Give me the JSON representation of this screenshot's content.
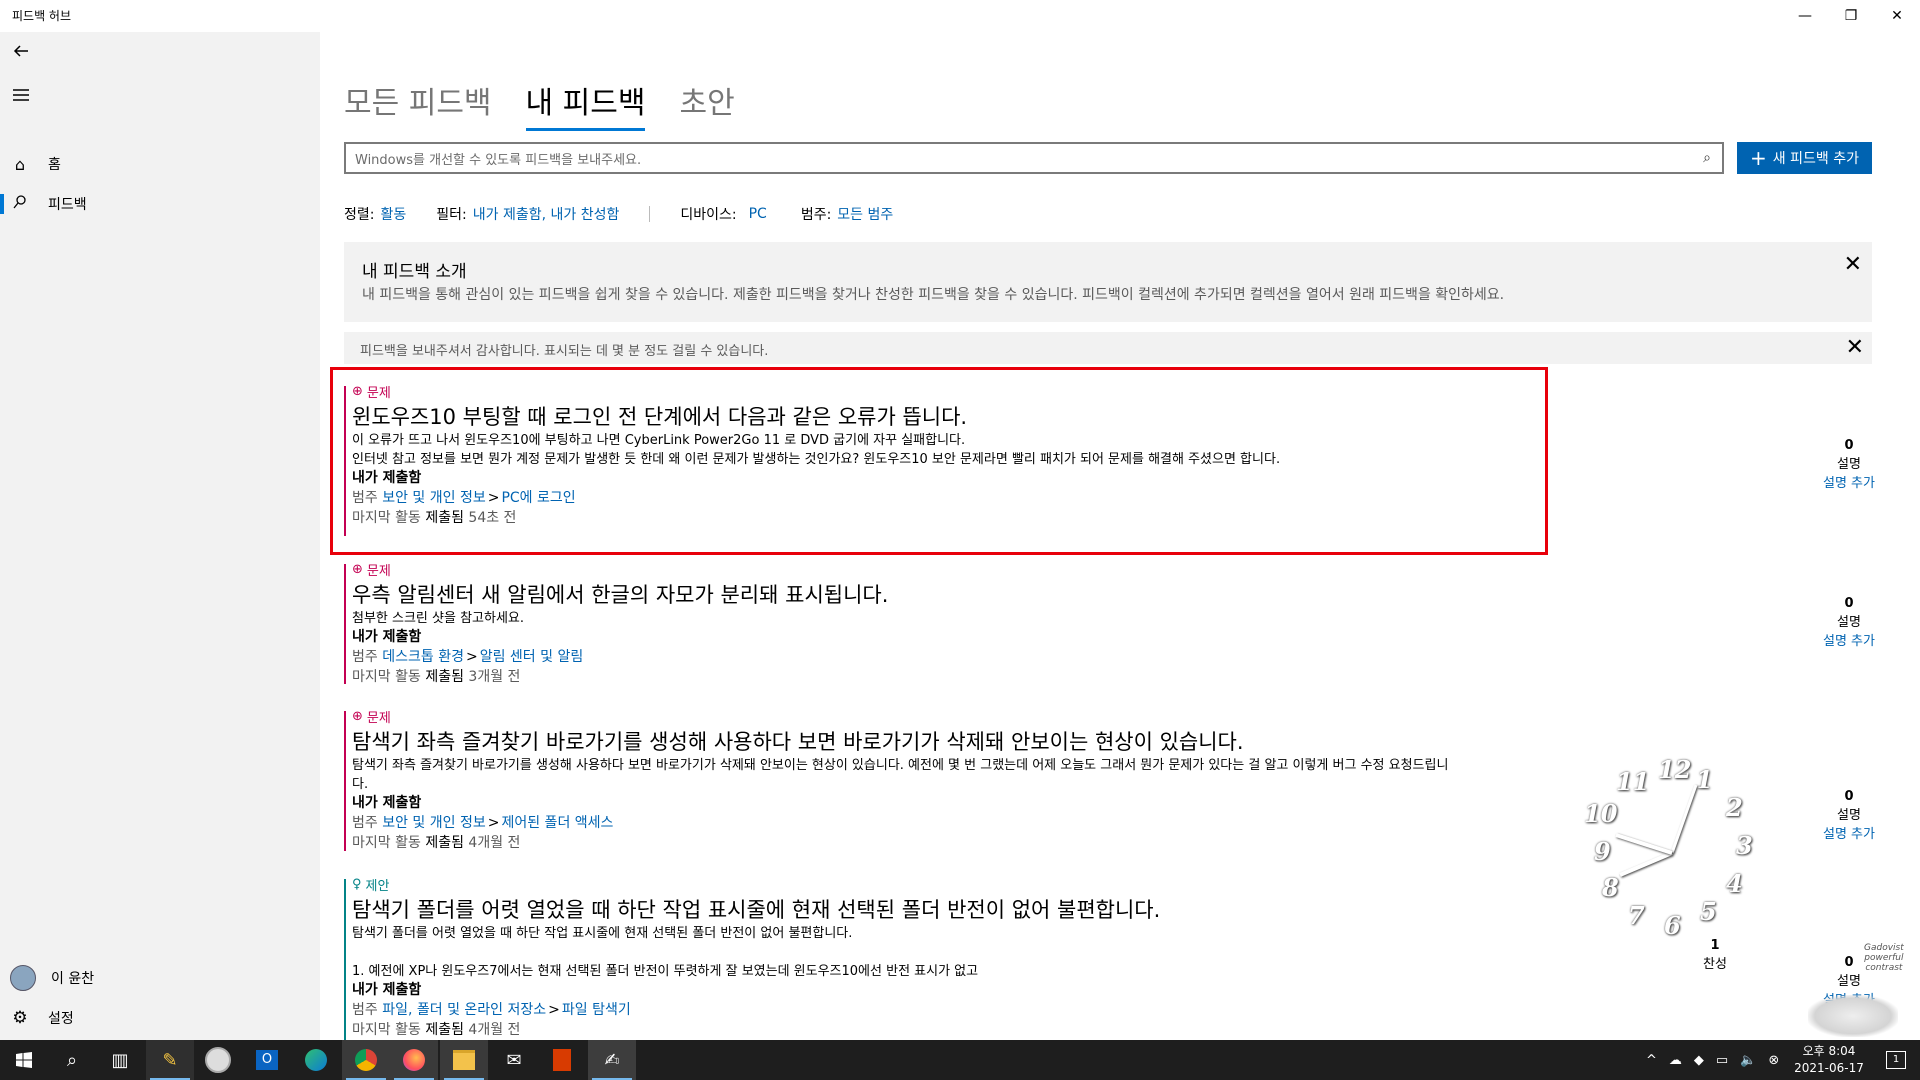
{
  "window": {
    "title": "피드백 허브",
    "minimize_icon": "minimize-icon",
    "maximize_icon": "restore-icon",
    "close_icon": "close-icon"
  },
  "sidebar": {
    "back_icon": "back-arrow-icon",
    "menu_icon": "hamburger-icon",
    "items": [
      {
        "label": "홈",
        "icon": "home-icon",
        "active": false
      },
      {
        "label": "피드백",
        "icon": "feedback-icon",
        "active": true
      }
    ],
    "user_name": "이 윤찬",
    "settings_label": "설정"
  },
  "tabs": [
    {
      "label": "모든 피드백",
      "active": false
    },
    {
      "label": "내 피드백",
      "active": true
    },
    {
      "label": "초안",
      "active": false
    }
  ],
  "search": {
    "placeholder": "Windows를 개선할 수 있도록 피드백을 보내주세요."
  },
  "new_button": {
    "label": "새 피드백 추가"
  },
  "filters": {
    "sort_key": "정렬:",
    "sort_value": "활동",
    "filter_key": "필터:",
    "filter_value": "내가 제출함, 내가 찬성함",
    "device_key": "디바이스:",
    "device_value": "PC",
    "category_key": "범주:",
    "category_value": "모든 범주"
  },
  "intro": {
    "title": "내 피드백 소개",
    "description": "내 피드백을 통해 관심이 있는 피드백을 쉽게 찾을 수 있습니다. 제출한 피드백을 찾거나 찬성한 피드백을 찾을 수 있습니다. 피드백이 컬렉션에 추가되면 컬렉션을 열어서 원래 피드백을 확인하세요."
  },
  "thanks": {
    "text": "피드백을 보내주셔서 감사합니다. 표시되는 데 몇 분 정도 걸릴 수 있습니다."
  },
  "feedback": [
    {
      "type": "문제",
      "title": "윈도우즈10 부팅할 때 로그인 전 단계에서 다음과 같은 오류가 뜹니다.",
      "desc_lines": [
        "이 오류가 뜨고 나서 윈도우즈10에 부팅하고 나면 CyberLink Power2Go 11 로 DVD 굽기에 자꾸 실패합니다.",
        "인터넷 참고 정보를 보면 뭔가 계정 문제가 발생한 듯 한데 왜 이런 문제가 발생하는 것인가요? 윈도우즈10 보안 문제라면 빨리 패치가 되어 문제를 해결해 주셨으면 합니다."
      ],
      "mine": "내가 제출함",
      "cat_prefix": "범주",
      "cat1": "보안 및 개인 정보",
      "cat2": "PC에 로그인",
      "act_prefix": "마지막 활동",
      "act_state": "제출됨",
      "act_time": "54초 전",
      "count": "0",
      "count_label": "설명",
      "add_label": "설명 추가"
    },
    {
      "type": "문제",
      "title": "우측 알림센터 새 알림에서 한글의 자모가 분리돼 표시됩니다.",
      "desc_lines": [
        "첨부한 스크린 샷을 참고하세요."
      ],
      "mine": "내가 제출함",
      "cat_prefix": "범주",
      "cat1": "데스크톱 환경",
      "cat2": "알림 센터 및 알림",
      "act_prefix": "마지막 활동",
      "act_state": "제출됨",
      "act_time": "3개월 전",
      "count": "0",
      "count_label": "설명",
      "add_label": "설명 추가"
    },
    {
      "type": "문제",
      "title": "탐색기 좌측 즐겨찾기 바로가기를 생성해 사용하다 보면 바로가기가 삭제돼 안보이는 현상이 있습니다.",
      "desc_lines": [
        "탐색기 좌측 즐겨찾기 바로가기를 생성해 사용하다 보면 바로가기가 삭제돼 안보이는 현상이 있습니다. 예전에 몇 번 그랬는데 어제 오늘도 그래서 뭔가 문제가 있다는 걸 알고 이렇게 버그 수정 요청드립니",
        "다."
      ],
      "mine": "내가 제출함",
      "cat_prefix": "범주",
      "cat1": "보안 및 개인 정보",
      "cat2": "제어된 폴더 액세스",
      "act_prefix": "마지막 활동",
      "act_state": "제출됨",
      "act_time": "4개월 전",
      "count": "0",
      "count_label": "설명",
      "add_label": "설명 추가"
    },
    {
      "type": "제안",
      "title": "탐색기 폴더를 어렷 열었을 때 하단 작업 표시줄에 현재 선택된 폴더 반전이 없어 불편합니다.",
      "desc_lines": [
        "탐색기 폴더를 어렷 열었을 때 하단 작업 표시줄에 현재 선택된 폴더 반전이 없어 불편합니다.",
        "",
        "1. 예전에 XP나 윈도우즈7에서는 현재 선택된 폴더 반전이 뚜렷하게 잘 보였는데 윈도우즈10에선 반전 표시가 없고"
      ],
      "mine": "내가 제출함",
      "cat_prefix": "범주",
      "cat1": "파일, 폴더 및 온라인 저장소",
      "cat2": "파일 탐색기",
      "act_prefix": "마지막 활동",
      "act_state": "제출됨",
      "act_time": "4개월 전",
      "count": "0",
      "count_label": "설명",
      "add_label": "설명 추가",
      "upvotes": "1",
      "upvote_label": "찬성"
    }
  ],
  "clock_gadget": {
    "numbers": [
      "12",
      "1",
      "2",
      "3",
      "4",
      "5",
      "6",
      "7",
      "8",
      "9",
      "10",
      "11"
    ],
    "caption_lines": [
      "Gadovist",
      "powerful",
      "contrast"
    ]
  },
  "taskbar": {
    "icons": [
      "windows-start-icon",
      "search-icon",
      "task-view-icon",
      "pen-app-icon",
      "clock-app-icon",
      "outlook-icon",
      "edge-icon",
      "chrome-icon",
      "firefox-icon",
      "file-explorer-icon",
      "mail-icon",
      "office-icon",
      "feedback-hub-icon"
    ],
    "time": "오후 8:04",
    "date": "2021-06-17",
    "notification_count": "1"
  }
}
